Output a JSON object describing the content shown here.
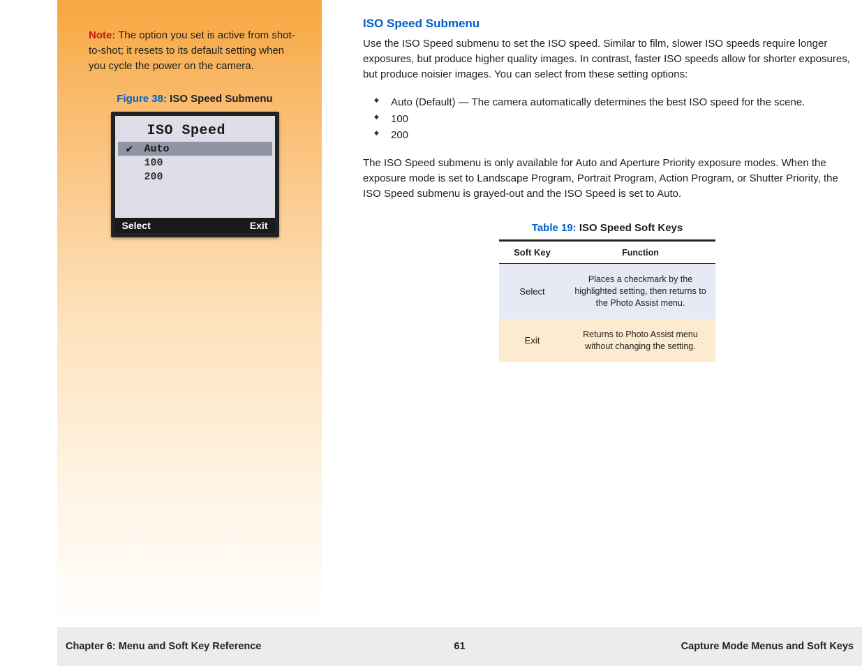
{
  "sidebar": {
    "note_label": "Note:",
    "note_text": " The option you set is active from shot-to-shot; it resets to its default setting when you cycle the power on the camera.",
    "figure_num": "Figure 38:",
    "figure_title": " ISO Speed Submenu",
    "lcd": {
      "title": "ISO Speed",
      "rows": [
        {
          "label": "Auto",
          "checked": true,
          "selected": true
        },
        {
          "label": "100",
          "checked": false,
          "selected": false
        },
        {
          "label": "200",
          "checked": false,
          "selected": false
        }
      ],
      "soft_left": "Select",
      "soft_right": "Exit"
    }
  },
  "main": {
    "heading": "ISO Speed Submenu",
    "para1": "Use the ISO Speed submenu to set the ISO speed. Similar to film, slower ISO speeds require longer exposures, but produce higher quality images. In contrast, faster ISO speeds allow for shorter exposures, but produce noisier images. You can select from these setting options:",
    "bullets": [
      "Auto (Default) — The camera automatically determines the best ISO speed for the scene.",
      "100",
      "200"
    ],
    "para2": "The ISO Speed submenu is only available for Auto and Aperture Priority exposure modes. When the exposure mode is set to Landscape Program, Portrait Program, Action Program, or Shutter Priority, the ISO Speed submenu is grayed-out and the ISO Speed is set to Auto.",
    "table_num": "Table 19:",
    "table_title": " ISO Speed Soft Keys",
    "table_head": {
      "c1": "Soft Key",
      "c2": "Function"
    },
    "table_rows": [
      {
        "key": "Select",
        "func": "Places a checkmark by the highlighted setting, then returns to the Photo Assist menu."
      },
      {
        "key": "Exit",
        "func": "Returns to Photo Assist menu without changing the setting."
      }
    ]
  },
  "footer": {
    "left": "Chapter 6: Menu and Soft Key Reference",
    "mid": "61",
    "right": "Capture Mode Menus and Soft Keys"
  }
}
